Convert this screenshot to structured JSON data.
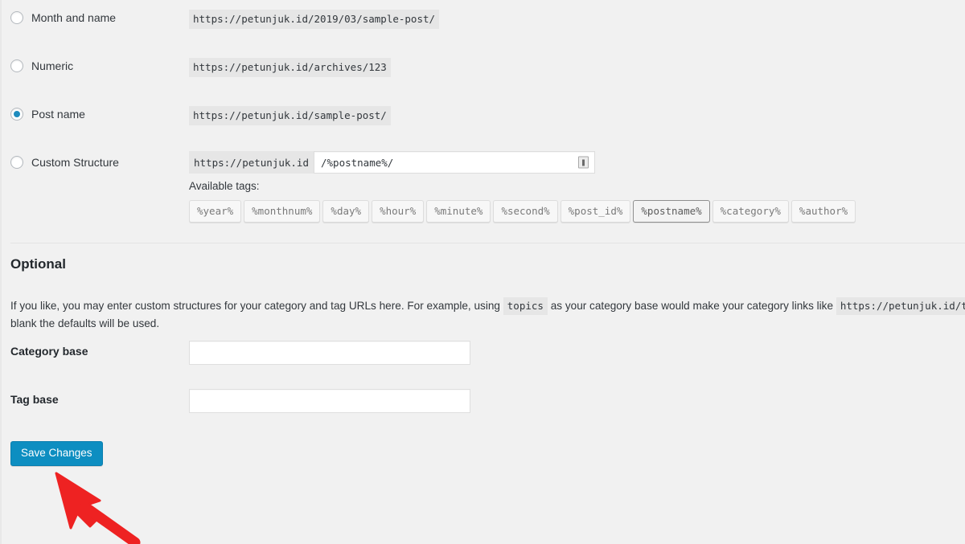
{
  "page": {
    "background_color": "#f1f1f1",
    "accent_color": "#0d8ec1"
  },
  "permalink_options": [
    {
      "label": "Month and name",
      "example_url": "https://petunjuk.id/2019/03/sample-post/",
      "selected": false
    },
    {
      "label": "Numeric",
      "example_url": "https://petunjuk.id/archives/123",
      "selected": false
    },
    {
      "label": "Post name",
      "example_url": "https://petunjuk.id/sample-post/",
      "selected": true
    }
  ],
  "custom_structure": {
    "label": "Custom Structure",
    "selected": false,
    "url_prefix": "https://petunjuk.id",
    "value": "/%postname%/",
    "placeholder": "",
    "badge_icon": "form-autofill-icon"
  },
  "available_tags": {
    "title": "Available tags:",
    "tags": [
      {
        "label": "%year%",
        "active": false
      },
      {
        "label": "%monthnum%",
        "active": false
      },
      {
        "label": "%day%",
        "active": false
      },
      {
        "label": "%hour%",
        "active": false
      },
      {
        "label": "%minute%",
        "active": false
      },
      {
        "label": "%second%",
        "active": false
      },
      {
        "label": "%post_id%",
        "active": false
      },
      {
        "label": "%postname%",
        "active": true
      },
      {
        "label": "%category%",
        "active": false
      },
      {
        "label": "%author%",
        "active": false
      }
    ]
  },
  "optional": {
    "heading": "Optional",
    "description_part1": "If you like, you may enter custom structures for your category and tag URLs here. For example, using",
    "code_topics": "topics",
    "description_part2": "as your category base would make your category links like",
    "code_example_url": "https://petunjuk.id/topics/uncategorized/",
    "description_part3": "these blank the defaults will be used.",
    "category_base": {
      "label": "Category base",
      "value": "",
      "placeholder": ""
    },
    "tag_base": {
      "label": "Tag base",
      "value": "",
      "placeholder": ""
    }
  },
  "save_button": {
    "label": "Save Changes"
  },
  "annotation": {
    "arrow_color": "#ee2222",
    "points_to": "save-changes-button"
  }
}
